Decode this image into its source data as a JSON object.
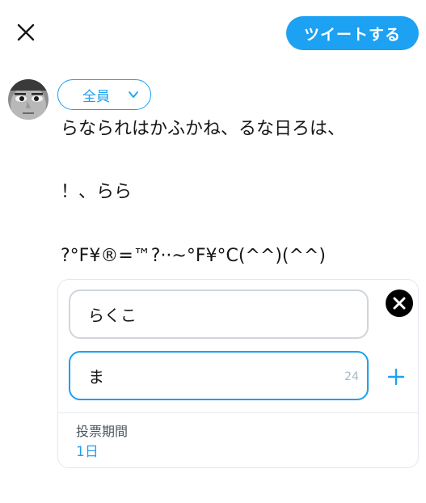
{
  "header": {
    "close_icon": "close-icon",
    "tweet_button_label": "ツイートする",
    "accent_color": "#1da1f2"
  },
  "composer": {
    "audience_label": "全員",
    "text_lines": [
      "らなられはかふかね、るな日ろは、",
      "！、らら",
      "?°F¥®=™?··~°F¥°C(^^)(^^)"
    ]
  },
  "poll": {
    "choice1_value": "らくこ",
    "choice2_value": "ま",
    "choice2_counter": "24",
    "length_label": "投票期間",
    "length_value": "1日"
  }
}
